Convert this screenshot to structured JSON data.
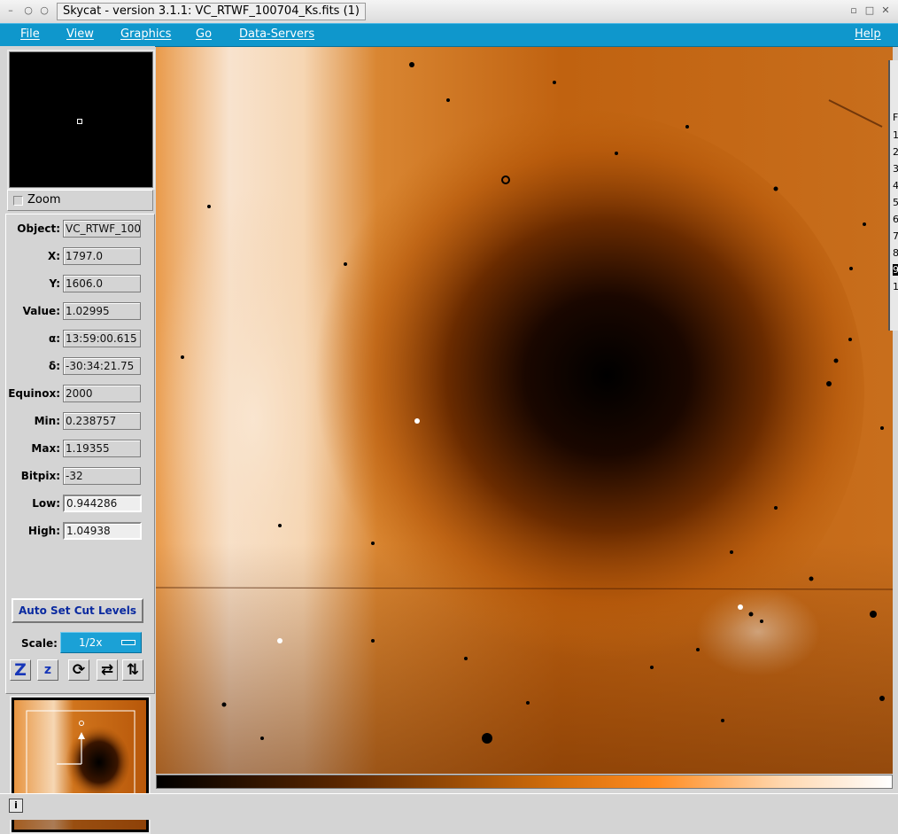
{
  "window": {
    "title": "Skycat - version 3.1.1: VC_RTWF_100704_Ks.fits (1)",
    "controls": {
      "left1": "–",
      "left2": "○",
      "left3": "○",
      "right1": "▫",
      "right2": "□",
      "right3": "✕"
    }
  },
  "menubar": {
    "items": [
      "File",
      "View",
      "Graphics",
      "Go",
      "Data-Servers"
    ],
    "help": "Help"
  },
  "panner": {
    "zoom_label": "Zoom"
  },
  "info": {
    "object": {
      "label": "Object:",
      "value": "VC_RTWF_100"
    },
    "x": {
      "label": "X:",
      "value": "1797.0"
    },
    "y": {
      "label": "Y:",
      "value": "1606.0"
    },
    "value": {
      "label": "Value:",
      "value": "1.02995"
    },
    "ra": {
      "label": "α:",
      "value": "13:59:00.615"
    },
    "dec": {
      "label": "δ:",
      "value": "-30:34:21.75"
    },
    "equinox": {
      "label": "Equinox:",
      "value": "2000"
    },
    "min": {
      "label": "Min:",
      "value": "0.238757"
    },
    "max": {
      "label": "Max:",
      "value": "1.19355"
    },
    "bitpix": {
      "label": "Bitpix:",
      "value": "-32"
    },
    "low": {
      "label": "Low:",
      "value": "0.944286"
    },
    "high": {
      "label": "High:",
      "value": "1.04938"
    }
  },
  "controls": {
    "auto_cut": "Auto Set Cut Levels",
    "scale_label": "Scale:",
    "scale_value": "1/2x"
  },
  "toolbar": {
    "zoom_in_glyph": "Z",
    "zoom_out_glyph": "z",
    "rotate_glyph": "⟳",
    "flip_x_glyph": "⇄",
    "flip_y_glyph": "⇅"
  },
  "status": {
    "icon_glyph": "i"
  },
  "side_window": {
    "rows": [
      "F",
      "1",
      "2",
      "3",
      "4",
      "5",
      "6",
      "7",
      "8",
      "9",
      "1"
    ]
  },
  "colors": {
    "menubar": "#0f97cc",
    "accent_text": "#0a2aa0",
    "colormap_dark": "#000000",
    "colormap_mid": "#e87a10",
    "colormap_light": "#ffffff"
  }
}
